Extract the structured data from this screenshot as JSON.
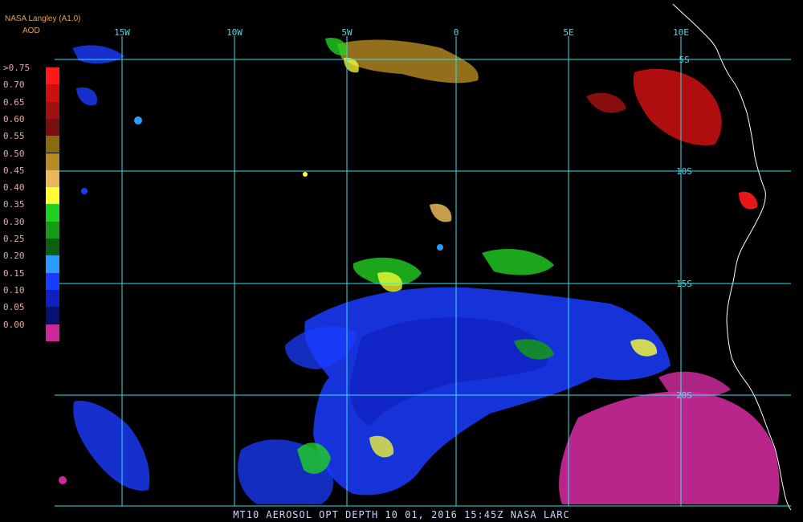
{
  "header": {
    "source": "NASA Langley (A1.0)",
    "product": "AOD"
  },
  "legend": {
    "labels": [
      ">0.75",
      "0.70",
      "0.65",
      "0.60",
      "0.55",
      "0.50",
      "0.45",
      "0.40",
      "0.35",
      "0.30",
      "0.25",
      "0.20",
      "0.15",
      "0.10",
      "0.05",
      "0.00"
    ],
    "colors": [
      "#ff1a1a",
      "#cc1010",
      "#a01010",
      "#7a0f0f",
      "#8b6a10",
      "#b88a22",
      "#e8b85a",
      "#ffff33",
      "#22d022",
      "#159a15",
      "#0c5f0c",
      "#2a9cff",
      "#1a3cff",
      "#1020c0",
      "#0a1070",
      "#cc2a9a"
    ]
  },
  "grid": {
    "longitude_labels": [
      "15W",
      "10W",
      "5W",
      "0",
      "5E",
      "10E"
    ],
    "latitude_labels": [
      "5S",
      "10S",
      "15S",
      "20S"
    ],
    "line_color": "#36e0f0"
  },
  "footer": {
    "caption": "MT10  AEROSOL OPT DEPTH  10 01, 2016 15:45Z  NASA LARC"
  },
  "map_colors": {
    "coastline": "#ffffff",
    "background": "#000000"
  }
}
